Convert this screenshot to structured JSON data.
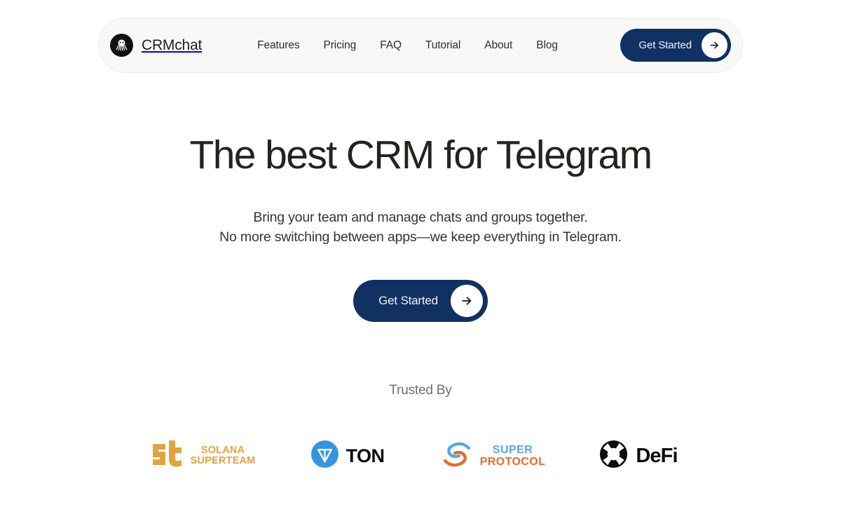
{
  "theme": {
    "page_background": "#ffffff",
    "navbar_background": "#f8f8f6",
    "accent_navy": "#123163",
    "text_dark": "#22241d",
    "text_muted": "#6f6f6d"
  },
  "navbar": {
    "brand": {
      "name": "CRMchat",
      "logo_icon": "octopus-logo-icon"
    },
    "links": [
      {
        "label": "Features"
      },
      {
        "label": "Pricing"
      },
      {
        "label": "FAQ"
      },
      {
        "label": "Tutorial"
      },
      {
        "label": "About"
      },
      {
        "label": "Blog"
      }
    ],
    "cta": {
      "label": "Get Started",
      "icon": "arrow-right-icon"
    }
  },
  "hero": {
    "title": "The best CRM for Telegram",
    "subtitle_line1": "Bring your team and manage chats and groups together.",
    "subtitle_line2": "No more switching between apps—we keep everything in Telegram.",
    "cta": {
      "label": "Get Started",
      "icon": "arrow-right-icon"
    }
  },
  "trusted": {
    "label": "Trusted By",
    "logos": [
      {
        "name": "Solana Superteam",
        "line1": "SOLANA",
        "line2": "SUPERTEAM",
        "color": "#e0a33e",
        "icon": "solana-superteam-logo-icon"
      },
      {
        "name": "TON",
        "wordmark": "TON",
        "color": "#3596e0",
        "icon": "ton-logo-icon"
      },
      {
        "name": "Super Protocol",
        "line1": "SUPER",
        "line2": "PROTOCOL",
        "color_line1": "#53a8e8",
        "color_line2": "#ea6a28",
        "icon": "super-protocol-logo-icon"
      },
      {
        "name": "DeFi",
        "wordmark": "DeFi",
        "color": "#0b0b0b",
        "icon": "defi-logo-icon"
      }
    ]
  }
}
